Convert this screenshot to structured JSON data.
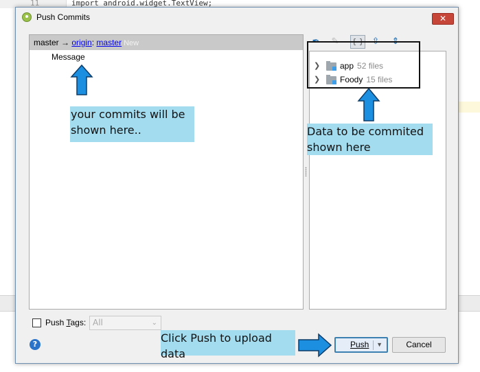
{
  "background": {
    "line_number": "11",
    "code_line": "import android.widget.TextView;"
  },
  "dialog": {
    "title": "Push Commits",
    "close_label": "✕",
    "branch": {
      "local": "master",
      "arrow": "→",
      "remote": "origin",
      "separator": ":",
      "target": "master",
      "badge": "New"
    },
    "message_header": "Message",
    "tree": [
      {
        "name": "app",
        "count": "52 files"
      },
      {
        "name": "Foody",
        "count": "15 files"
      }
    ],
    "push_tags_label_pre": "Push ",
    "push_tags_label_key": "T",
    "push_tags_label_post": "ags:",
    "tags_select_value": "All",
    "push_button_label": "Push",
    "cancel_button_label": "Cancel",
    "help_label": "?"
  },
  "annotations": {
    "commits_note": "your commits will be shown here..",
    "data_note": "Data to be commited shown here",
    "push_note": "Click Push to upload data"
  },
  "colors": {
    "annotation_bg": "#a3dcef",
    "arrow_fill": "#1c8fe0",
    "close_red": "#c7463a",
    "push_border": "#3c7fb1"
  }
}
